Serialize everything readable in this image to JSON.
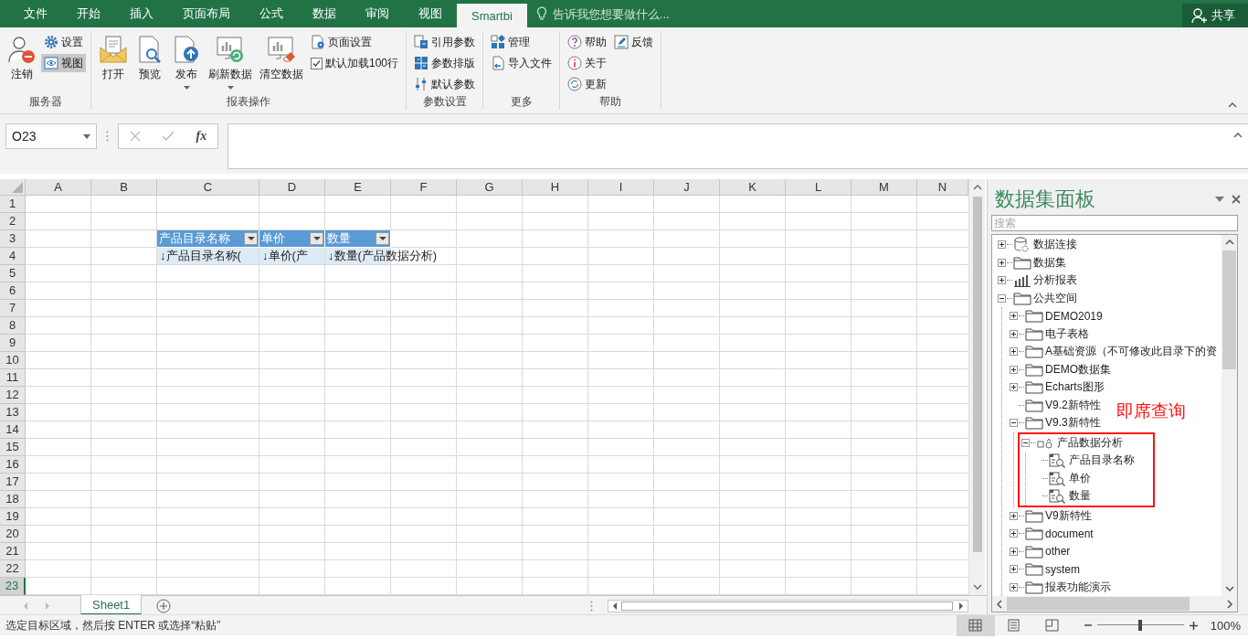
{
  "ribbon_tabs": [
    {
      "label": "文件",
      "selected": false
    },
    {
      "label": "开始",
      "selected": false
    },
    {
      "label": "插入",
      "selected": false
    },
    {
      "label": "页面布局",
      "selected": false
    },
    {
      "label": "公式",
      "selected": false
    },
    {
      "label": "数据",
      "selected": false
    },
    {
      "label": "审阅",
      "selected": false
    },
    {
      "label": "视图",
      "selected": false
    },
    {
      "label": "Smartbi",
      "selected": true
    }
  ],
  "tell_me": {
    "placeholder": "告诉我您想要做什么..."
  },
  "share_button": {
    "label": "共享"
  },
  "ribbon_groups": [
    {
      "label": "服务器",
      "items": [
        {
          "kind": "large",
          "label": "注销"
        },
        {
          "kind": "small",
          "label": "设置"
        },
        {
          "kind": "toggle",
          "label": "视图",
          "on": true
        }
      ]
    },
    {
      "label": "报表操作",
      "items": [
        {
          "kind": "large",
          "label": "打开"
        },
        {
          "kind": "large",
          "label": "预览"
        },
        {
          "kind": "large",
          "label": "发布",
          "menu": true
        },
        {
          "kind": "large",
          "label": "刷新数据",
          "menu": true
        },
        {
          "kind": "large",
          "label": "清空数据"
        },
        {
          "kind": "small",
          "label": "页面设置"
        },
        {
          "kind": "check",
          "label": "默认加载100行",
          "checked": true
        }
      ]
    },
    {
      "label": "参数设置",
      "items": [
        {
          "kind": "small",
          "label": "引用参数"
        },
        {
          "kind": "small",
          "label": "参数排版"
        },
        {
          "kind": "small",
          "label": "默认参数"
        }
      ]
    },
    {
      "label": "更多",
      "items": [
        {
          "kind": "small",
          "label": "管理"
        },
        {
          "kind": "small",
          "label": "导入文件"
        }
      ]
    },
    {
      "label": "帮助",
      "items": [
        {
          "kind": "small",
          "label": "帮助"
        },
        {
          "kind": "small",
          "label": "关于"
        },
        {
          "kind": "small",
          "label": "更新"
        },
        {
          "kind": "small",
          "label": "反馈"
        }
      ]
    }
  ],
  "formula_bar": {
    "name_box": "O23",
    "function_label": "fx"
  },
  "sheet": {
    "columns": [
      "A",
      "B",
      "C",
      "D",
      "E",
      "F",
      "G",
      "H",
      "I",
      "J",
      "K",
      "L",
      "M",
      "N"
    ],
    "rows": [
      {
        "label": "1",
        "selected": false
      },
      {
        "label": "2",
        "selected": false
      },
      {
        "label": "3",
        "selected": false,
        "cells": [
          null,
          null,
          {
            "kind": "header",
            "text": "产品目录名称"
          },
          {
            "kind": "header",
            "text": "单价"
          },
          {
            "kind": "header",
            "text": "数量"
          }
        ]
      },
      {
        "label": "4",
        "selected": false,
        "cells": [
          null,
          null,
          {
            "kind": "field",
            "text": "↓产品目录名称("
          },
          {
            "kind": "field",
            "text": "↓单价(产"
          },
          {
            "kind": "field",
            "text": "↓数量(产品数据分析)"
          }
        ]
      },
      {
        "label": "5",
        "selected": false
      },
      {
        "label": "6",
        "selected": false
      },
      {
        "label": "7",
        "selected": false
      },
      {
        "label": "8",
        "selected": false
      },
      {
        "label": "9",
        "selected": false
      },
      {
        "label": "10",
        "selected": false
      },
      {
        "label": "11",
        "selected": false
      },
      {
        "label": "12",
        "selected": false
      },
      {
        "label": "13",
        "selected": false
      },
      {
        "label": "14",
        "selected": false
      },
      {
        "label": "15",
        "selected": false
      },
      {
        "label": "16",
        "selected": false
      },
      {
        "label": "17",
        "selected": false
      },
      {
        "label": "18",
        "selected": false
      },
      {
        "label": "19",
        "selected": false
      },
      {
        "label": "20",
        "selected": false
      },
      {
        "label": "21",
        "selected": false
      },
      {
        "label": "22",
        "selected": false
      },
      {
        "label": "23",
        "selected": true
      }
    ]
  },
  "sheet_tabs": [
    {
      "label": "Sheet1",
      "selected": true
    }
  ],
  "task_pane": {
    "title": "数据集面板",
    "search": {
      "placeholder": "搜索"
    },
    "tree": [
      {
        "kind": "datasource",
        "label": "数据连接",
        "expanded": false
      },
      {
        "kind": "folder",
        "label": "数据集",
        "expanded": false
      },
      {
        "kind": "report",
        "label": "分析报表",
        "expanded": false
      },
      {
        "kind": "folder",
        "label": "公共空间",
        "expanded": true,
        "children": [
          {
            "kind": "folder",
            "label": "DEMO2019",
            "expanded": false
          },
          {
            "kind": "folder",
            "label": "电子表格",
            "expanded": false
          },
          {
            "kind": "folder",
            "label": "A基础资源（不可修改此目录下的资",
            "expanded": false
          },
          {
            "kind": "folder",
            "label": "DEMO数据集",
            "expanded": false
          },
          {
            "kind": "folder",
            "label": "Echarts图形",
            "expanded": false
          },
          {
            "kind": "folder",
            "label": "V9.2新特性"
          },
          {
            "kind": "folder",
            "label": "V9.3新特性",
            "expanded": true,
            "children": [
              {
                "kind": "query",
                "label": "产品数据分析",
                "expanded": true,
                "annotation": "即席查询",
                "children": [
                  {
                    "kind": "field",
                    "label": "产品目录名称"
                  },
                  {
                    "kind": "field",
                    "label": "单价"
                  },
                  {
                    "kind": "field",
                    "label": "数量"
                  }
                ]
              }
            ]
          },
          {
            "kind": "folder",
            "label": "V9新特性",
            "expanded": false
          },
          {
            "kind": "folder",
            "label": "document",
            "expanded": false
          },
          {
            "kind": "folder",
            "label": "other",
            "expanded": false
          },
          {
            "kind": "folder",
            "label": "system",
            "expanded": false
          },
          {
            "kind": "folder",
            "label": "报表功能演示",
            "expanded": false
          }
        ]
      }
    ]
  },
  "status_bar": {
    "message": "选定目标区域，然后按 ENTER 或选择“粘贴”",
    "views": [
      {
        "selected": true
      },
      {
        "selected": false
      },
      {
        "selected": false
      }
    ],
    "zoom": {
      "level": 0.5,
      "reading": "100%"
    }
  }
}
